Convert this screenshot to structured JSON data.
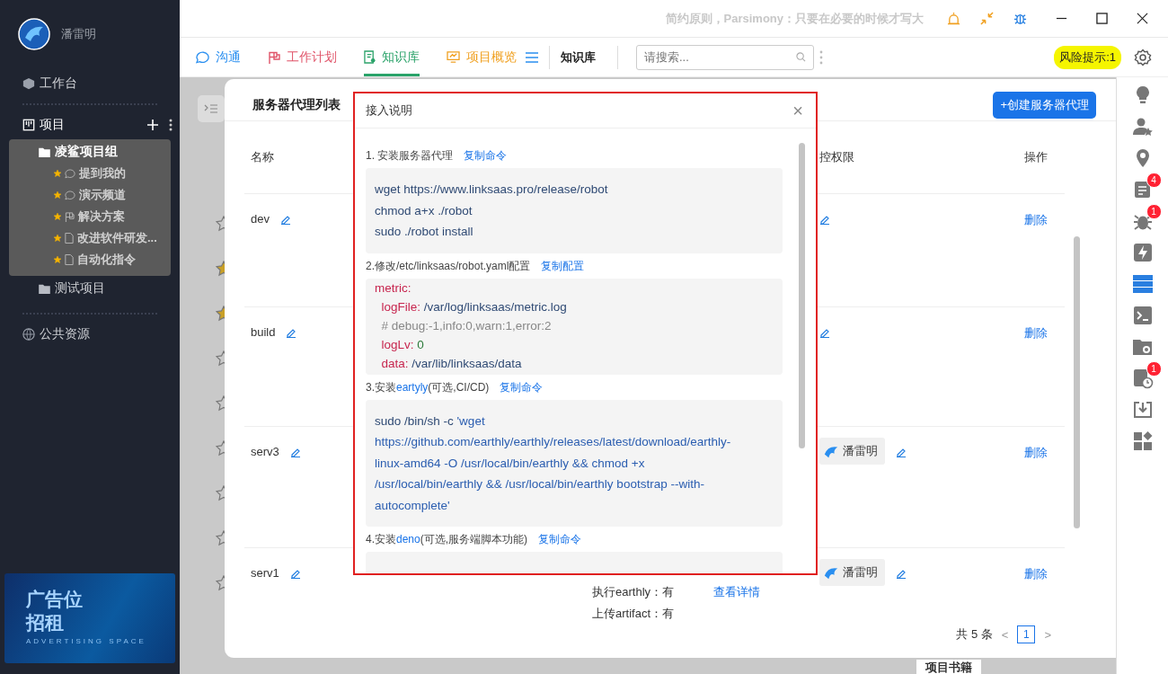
{
  "title_bar": {
    "marquee": "简约原则，Parsimony：只要在必要的时候才写大"
  },
  "sidebar": {
    "user": "潘雷明",
    "workbench": "工作台",
    "projects_label": "项目",
    "groups": [
      {
        "label": "凌鲨项目组",
        "selected": true,
        "children": [
          {
            "label": "提到我的",
            "kind": "chat",
            "starred": true
          },
          {
            "label": "演示频道",
            "kind": "chat",
            "starred": true
          },
          {
            "label": "解决方案",
            "kind": "flag",
            "starred": true
          },
          {
            "label": "改进软件研发...",
            "kind": "doc",
            "starred": true
          },
          {
            "label": "自动化指令",
            "kind": "doc",
            "starred": true
          }
        ]
      },
      {
        "label": "测试项目",
        "selected": false
      }
    ],
    "public": "公共资源",
    "ad": {
      "line1": "广告位",
      "line2": "招租",
      "subtitle": "ADVERTISING SPACE"
    }
  },
  "tabs": [
    {
      "label": "沟通",
      "kind": "chat",
      "color": "#2a8ff0",
      "selected": false
    },
    {
      "label": "工作计划",
      "kind": "flag",
      "color": "#e0556a",
      "selected": false
    },
    {
      "label": "知识库",
      "kind": "book",
      "color": "#2ba36a",
      "selected": true
    },
    {
      "label": "项目概览",
      "kind": "screen",
      "color": "#f0a020",
      "selected": false
    }
  ],
  "breadcrumb": "知识库",
  "search": {
    "placeholder": "请搜索..."
  },
  "risk_badge": "风险提示:1",
  "right_bar": [
    {
      "kind": "bulb"
    },
    {
      "kind": "user-star"
    },
    {
      "kind": "pin"
    },
    {
      "kind": "doc",
      "badge": "4"
    },
    {
      "kind": "bug",
      "badge": "1"
    },
    {
      "kind": "bolt"
    },
    {
      "kind": "server"
    },
    {
      "kind": "terminal"
    },
    {
      "kind": "folder"
    },
    {
      "kind": "doc-clock",
      "badge": "1"
    },
    {
      "kind": "download"
    },
    {
      "kind": "apps"
    }
  ],
  "background_list": [
    {
      "starred": false
    },
    {
      "starred": true
    },
    {
      "starred": true
    },
    {
      "starred": false
    },
    {
      "starred": false
    },
    {
      "starred": false
    },
    {
      "starred": false
    },
    {
      "starred": false
    },
    {
      "starred": false
    }
  ],
  "panel": {
    "title": "服务器代理列表",
    "create_button": "+创建服务器代理",
    "columns": [
      "名称",
      "",
      "控权限",
      "操作"
    ],
    "rows": [
      {
        "name": "dev",
        "monitor_edit": true,
        "action": "删除"
      },
      {
        "name": "build",
        "monitor_edit": true,
        "action": "删除"
      },
      {
        "name": "serv3",
        "owner": "潘雷明",
        "monitor_edit": true,
        "action": "删除"
      },
      {
        "name": "serv1",
        "owner": "潘雷明",
        "monitor_edit": true,
        "action": "删除",
        "details": [
          "执行earthly：有",
          "上传artifact：有"
        ],
        "details_link": "查看详情"
      }
    ],
    "pagination": {
      "total": "共 5 条",
      "prev": "<",
      "next": ">",
      "pages": [
        {
          "label": "1",
          "selected": true
        }
      ]
    },
    "footer_peek": "项目书籍"
  },
  "modal": {
    "title": "接入说明",
    "close": "×",
    "steps": [
      {
        "prefix": "1. 安装服务器代理",
        "action": "复制命令",
        "kind": "shell",
        "lines": [
          [
            {
              "t": "wget https://www.linksaas.pro/release/robot",
              "kind": "plain"
            }
          ],
          [
            {
              "t": "chmod a+x ./robot",
              "kind": "plain"
            }
          ],
          [
            {
              "t": "sudo ./robot install",
              "kind": "plain"
            }
          ]
        ]
      },
      {
        "prefix": "2.修改/etc/linksaas/robot.yaml配置",
        "action": "复制配置",
        "kind": "yaml",
        "lines": [
          [
            {
              "t": "metric:",
              "kind": "key"
            }
          ],
          [
            {
              "t": "  logFile:",
              "kind": "key"
            },
            {
              "t": " /var/log/linksaas/metric.log",
              "kind": "plain"
            }
          ],
          [
            {
              "t": "  # debug:-1,info:0,warn:1,error:2",
              "kind": "comment"
            }
          ],
          [
            {
              "t": "  logLv:",
              "kind": "key"
            },
            {
              "t": " 0",
              "kind": "number"
            }
          ],
          [
            {
              "t": "  data:",
              "kind": "key"
            },
            {
              "t": " /var/lib/linksaas/data",
              "kind": "plain"
            }
          ]
        ]
      },
      {
        "prefix": "3.安装",
        "link": "eartyly",
        "suffix": "(可选,CI/CD)",
        "action": "复制命令",
        "kind": "wrap",
        "lines": [
          [
            {
              "t": "sudo /bin/sh -c ",
              "kind": "plain"
            },
            {
              "t": "'wget",
              "kind": "string"
            }
          ],
          [
            {
              "t": "https://github.com/earthly/earthly/releases/latest/download/earthly-",
              "kind": "string"
            }
          ],
          [
            {
              "t": "linux-amd64 -O /usr/local/bin/earthly && chmod +x",
              "kind": "string"
            }
          ],
          [
            {
              "t": "/usr/local/bin/earthly && /usr/local/bin/earthly bootstrap --with-",
              "kind": "string"
            }
          ],
          [
            {
              "t": "autocomplete'",
              "kind": "string"
            }
          ]
        ]
      },
      {
        "prefix": "4.安装",
        "link": "deno",
        "suffix": "(可选,服务端脚本功能)",
        "action": "复制命令",
        "kind": "shell"
      }
    ]
  }
}
